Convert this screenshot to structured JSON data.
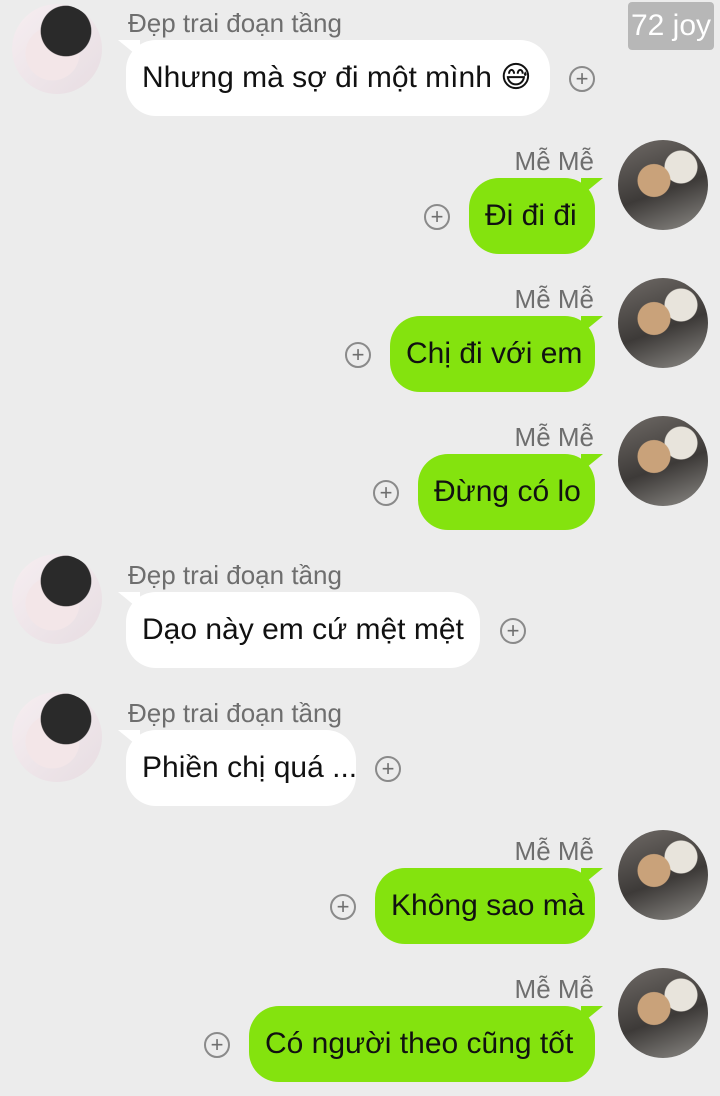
{
  "watermark": "72 joy",
  "colors": {
    "background": "#ececec",
    "incoming_bubble": "#ffffff",
    "outgoing_bubble": "#84e30e"
  },
  "messages": [
    {
      "sender": "Đẹp trai đoạn tầng",
      "text": "Nhưng mà sợ đi một mình 😅",
      "direction": "incoming"
    },
    {
      "sender": "Mễ Mễ",
      "text": "Đi đi đi",
      "direction": "outgoing"
    },
    {
      "sender": "Mễ Mễ",
      "text": "Chị đi với em",
      "direction": "outgoing"
    },
    {
      "sender": "Mễ Mễ",
      "text": "Đừng có lo",
      "direction": "outgoing"
    },
    {
      "sender": "Đẹp trai đoạn tầng",
      "text": "Dạo này em cứ mệt mệt",
      "direction": "incoming"
    },
    {
      "sender": "Đẹp trai đoạn tầng",
      "text": "Phiền chị quá ...",
      "direction": "incoming"
    },
    {
      "sender": "Mễ Mễ",
      "text": "Không sao mà",
      "direction": "outgoing"
    },
    {
      "sender": "Mễ Mễ",
      "text": "Có người theo cũng tốt",
      "direction": "outgoing"
    }
  ],
  "icons": {
    "add": "plus-circle-icon"
  }
}
